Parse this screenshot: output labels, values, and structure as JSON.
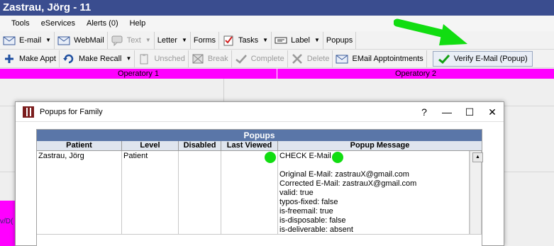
{
  "window": {
    "title": "Zastrau, Jörg - 11"
  },
  "menu": [
    "Tools",
    "eServices",
    "Alerts (0)",
    "Help"
  ],
  "toolbar1": {
    "email": "E-mail",
    "webmail": "WebMail",
    "text": "Text",
    "letter": "Letter",
    "forms": "Forms",
    "tasks": "Tasks",
    "label": "Label",
    "popups": "Popups"
  },
  "toolbar2": {
    "make_appt": "Make Appt",
    "make_recall": "Make Recall",
    "unsched": "Unsched",
    "break": "Break",
    "complete": "Complete",
    "delete": "Delete",
    "email_appointments": "EMail Apptointments",
    "verify": "Verify E-Mail (Popup)"
  },
  "operatories": [
    "Operatory 1",
    "Operatory 2"
  ],
  "schedule": {
    "partial_text": "v/D("
  },
  "popup": {
    "title": "Popups for Family",
    "window_buttons": [
      "?",
      "—",
      "☐",
      "✕"
    ],
    "table_title": "Popups",
    "columns": [
      "Patient",
      "Level",
      "Disabled",
      "Last Viewed",
      "Popup Message"
    ],
    "row": {
      "patient": "Zastrau, Jörg",
      "level": "Patient",
      "disabled": "",
      "last_viewed": "",
      "message_lines": [
        "CHECK E-Mail",
        "",
        "Original E-Mail: zastrauX@gmail.com",
        "Corrected E-Mail: zastrauX@gmail.com",
        "valid: true",
        "typos-fixed: false",
        "is-freemail: true",
        "is-disposable: false",
        "is-deliverable: absent"
      ]
    }
  },
  "colors": {
    "titlebar": "#3a4d8f",
    "operatory": "#ff00ff",
    "table_header": "#5a76a8",
    "annotation": "#11dd11"
  }
}
